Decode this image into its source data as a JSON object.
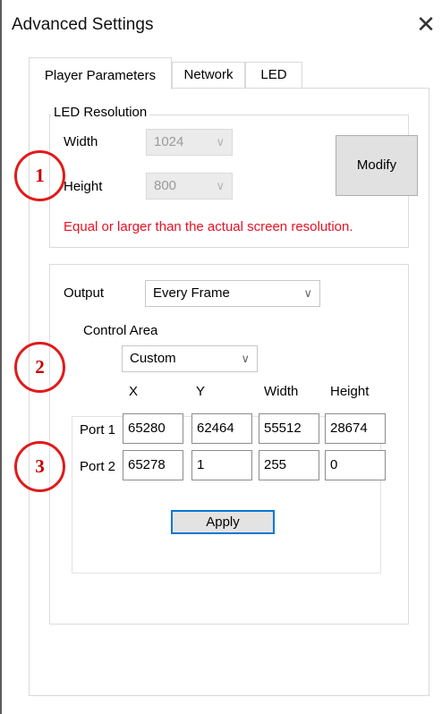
{
  "window": {
    "title": "Advanced Settings",
    "close_glyph": "✕"
  },
  "tabs": [
    {
      "label": "Player Parameters",
      "active": true
    },
    {
      "label": "Network",
      "active": false
    },
    {
      "label": "LED",
      "active": false
    }
  ],
  "led_resolution": {
    "legend": "LED Resolution",
    "width_label": "Width",
    "width_value": "1024",
    "height_label": "Height",
    "height_value": "800",
    "modify_label": "Modify",
    "warning": "Equal or larger than the actual screen resolution.",
    "warning_color": "#e81123",
    "disabled": true
  },
  "output": {
    "label": "Output",
    "value": "Every Frame",
    "control_area": {
      "legend": "Control Area",
      "mode": "Custom",
      "columns": [
        "X",
        "Y",
        "Width",
        "Height"
      ],
      "rows": [
        {
          "label": "Port 1",
          "values": [
            "65280",
            "62464",
            "55512",
            "28674"
          ]
        },
        {
          "label": "Port 2",
          "values": [
            "65278",
            "1",
            "255",
            "0"
          ]
        }
      ]
    },
    "apply_label": "Apply"
  },
  "markers": [
    "1",
    "2",
    "3"
  ],
  "colors": {
    "marker": "#e01b1b",
    "focus": "#0078d7"
  },
  "icons": {
    "dropdown": "chevron-down-icon",
    "close": "close-icon"
  }
}
